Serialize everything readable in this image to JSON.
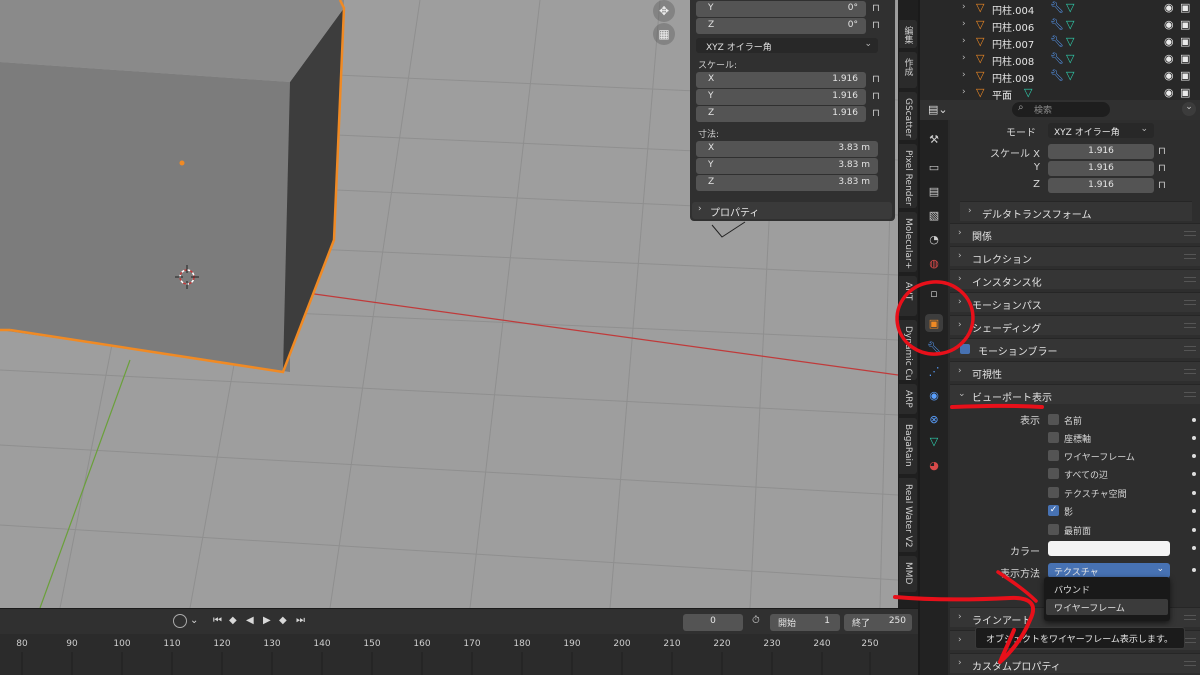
{
  "npanel": {
    "rot_y": {
      "k": "Y",
      "v": "0°"
    },
    "rot_z": {
      "k": "Z",
      "v": "0°"
    },
    "rotation_mode": "XYZ オイラー角",
    "scale_label": "スケール:",
    "scale": [
      {
        "k": "X",
        "v": "1.916"
      },
      {
        "k": "Y",
        "v": "1.916"
      },
      {
        "k": "Z",
        "v": "1.916"
      }
    ],
    "dims_label": "寸法:",
    "dims": [
      {
        "k": "X",
        "v": "3.83 m"
      },
      {
        "k": "Y",
        "v": "3.83 m"
      },
      {
        "k": "Z",
        "v": "3.83 m"
      }
    ],
    "properties": "プロパティ"
  },
  "vtabs": [
    "編集",
    "作成",
    "GScatter",
    "Pixel Render",
    "Molecular+",
    "ANT",
    "Dynamic Cut",
    "ARP",
    "BagaRain",
    "Real Water V2",
    "MMD"
  ],
  "timeline": {
    "current_frame": "0",
    "start_label": "開始",
    "start": "1",
    "end_label": "終了",
    "end": "250",
    "ticks": [
      "80",
      "90",
      "100",
      "110",
      "120",
      "130",
      "140",
      "150",
      "160",
      "170",
      "180",
      "190",
      "200",
      "210",
      "220",
      "230",
      "240",
      "250"
    ]
  },
  "outliner": {
    "rows": [
      "円柱.004",
      "円柱.006",
      "円柱.007",
      "円柱.008",
      "円柱.009",
      "平面"
    ]
  },
  "props": {
    "search_placeholder": "検索",
    "mode_label": "モード",
    "mode_value": "XYZ オイラー角",
    "scale_x_label": "スケール X",
    "scale_y_label": "Y",
    "scale_z_label": "Z",
    "scale_x": "1.916",
    "scale_y": "1.916",
    "scale_z": "1.916",
    "delta_transform": "デルタトランスフォーム",
    "sections": [
      "関係",
      "コレクション",
      "インスタンス化",
      "モーションパス",
      "シェーディング"
    ],
    "motion_blur": "モーションブラー",
    "visibility": "可視性",
    "viewport_display": "ビューポート表示",
    "show_label": "表示",
    "checkboxes": [
      {
        "label": "名前",
        "checked": false
      },
      {
        "label": "座標軸",
        "checked": false
      },
      {
        "label": "ワイヤーフレーム",
        "checked": false
      },
      {
        "label": "すべての辺",
        "checked": false
      },
      {
        "label": "テクスチャ空間",
        "checked": false
      },
      {
        "label": "影",
        "checked": true
      },
      {
        "label": "最前面",
        "checked": false
      }
    ],
    "color_label": "カラー",
    "display_as_label": "表示方法",
    "display_as_value": "テクスチャ",
    "popup_items": [
      "バウンド",
      "ワイヤーフレーム"
    ],
    "line_art": "ラインアート",
    "custom_props": "カスタムプロパティ",
    "tooltip": "オブジェクトをワイヤーフレーム表示します。"
  },
  "colors": {
    "selection_outline": "#f08a24",
    "annotation_red": "#e8101a",
    "x_axis": "#c03a3a",
    "y_axis": "#6aa03a",
    "checkbox_on": "#4772b3"
  }
}
